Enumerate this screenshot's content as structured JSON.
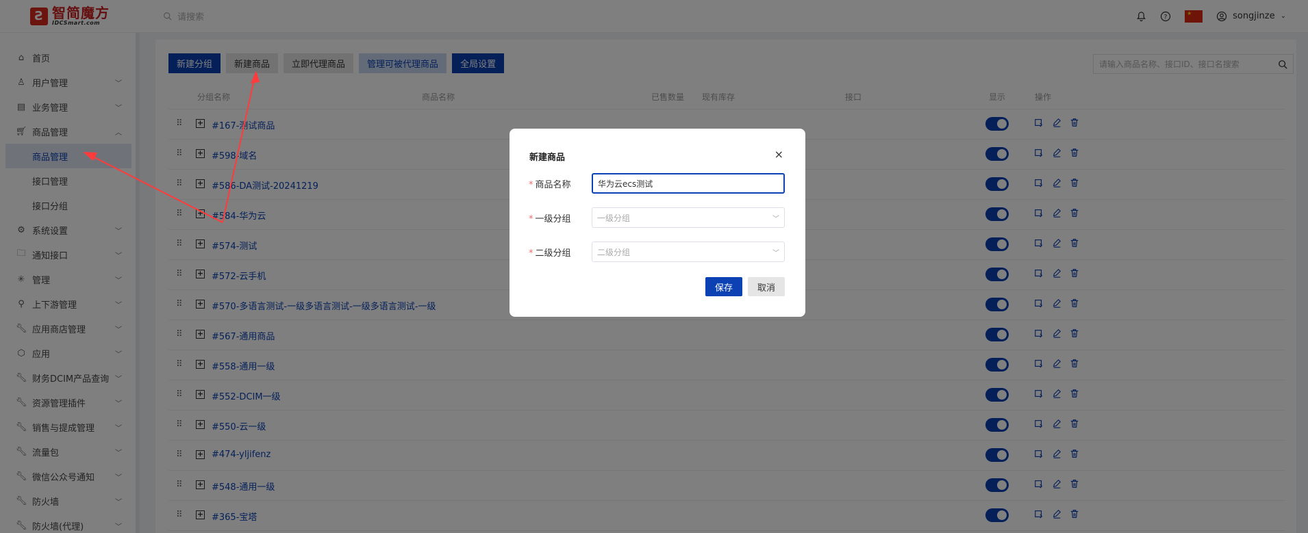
{
  "header": {
    "logo_cn": "智简魔方",
    "logo_en": "IDCSmart.com",
    "search_placeholder": "请搜索",
    "username": "songjinze"
  },
  "sidebar": {
    "items": [
      {
        "label": "首页",
        "icon": "home-icon"
      },
      {
        "label": "用户管理",
        "icon": "user-icon"
      },
      {
        "label": "业务管理",
        "icon": "list-icon"
      },
      {
        "label": "商品管理",
        "icon": "cart-icon"
      },
      {
        "label": "商品管理"
      },
      {
        "label": "接口管理"
      },
      {
        "label": "接口分组"
      },
      {
        "label": "系统设置",
        "icon": "gear-icon"
      },
      {
        "label": "通知接口",
        "icon": "folder-icon"
      },
      {
        "label": "管理",
        "icon": "sparkle-icon"
      },
      {
        "label": "上下游管理",
        "icon": "hierarchy-icon"
      },
      {
        "label": "应用商店管理",
        "icon": "wrench-icon"
      },
      {
        "label": "应用",
        "icon": "box-icon"
      },
      {
        "label": "财务DCIM产品查询",
        "icon": "wrench-icon"
      },
      {
        "label": "资源管理插件",
        "icon": "wrench-icon"
      },
      {
        "label": "销售与提成管理",
        "icon": "wrench-icon"
      },
      {
        "label": "流量包",
        "icon": "wrench-icon"
      },
      {
        "label": "微信公众号通知",
        "icon": "wrench-icon"
      },
      {
        "label": "防火墙",
        "icon": "wrench-icon"
      },
      {
        "label": "防火墙(代理)",
        "icon": "wrench-icon"
      }
    ]
  },
  "toolbar": {
    "new_group": "新建分组",
    "new_product": "新建商品",
    "proxy_now": "立即代理商品",
    "manage_proxy": "管理可被代理商品",
    "global_settings": "全局设置",
    "search_placeholder": "请输入商品名称、接口ID、接口名搜索"
  },
  "table": {
    "headers": {
      "group": "分组名称",
      "product": "商品名称",
      "sold": "已售数量",
      "stock": "现有库存",
      "interface": "接口",
      "show": "显示",
      "ops": "操作"
    },
    "rows": [
      "#167-测试商品",
      "#598-域名",
      "#586-DA测试-20241219",
      "#584-华为云",
      "#574-测试",
      "#572-云手机",
      "#570-多语言测试-一级多语言测试-一级多语言测试-一级",
      "#567-通用商品",
      "#558-通用一级",
      "#552-DCIM一级",
      "#550-云一级",
      "#474-yljifenz",
      "#548-通用一级",
      "#365-宝塔"
    ]
  },
  "dialog": {
    "title": "新建商品",
    "close": "×",
    "name_label": "商品名称",
    "name_value": "华为云ecs测试",
    "group1_label": "一级分组",
    "group1_placeholder": "一级分组",
    "group2_label": "二级分组",
    "group2_placeholder": "二级分组",
    "save": "保存",
    "cancel": "取消"
  },
  "colors": {
    "primary": "#0b41b3",
    "annotation": "#ff3b3b"
  }
}
